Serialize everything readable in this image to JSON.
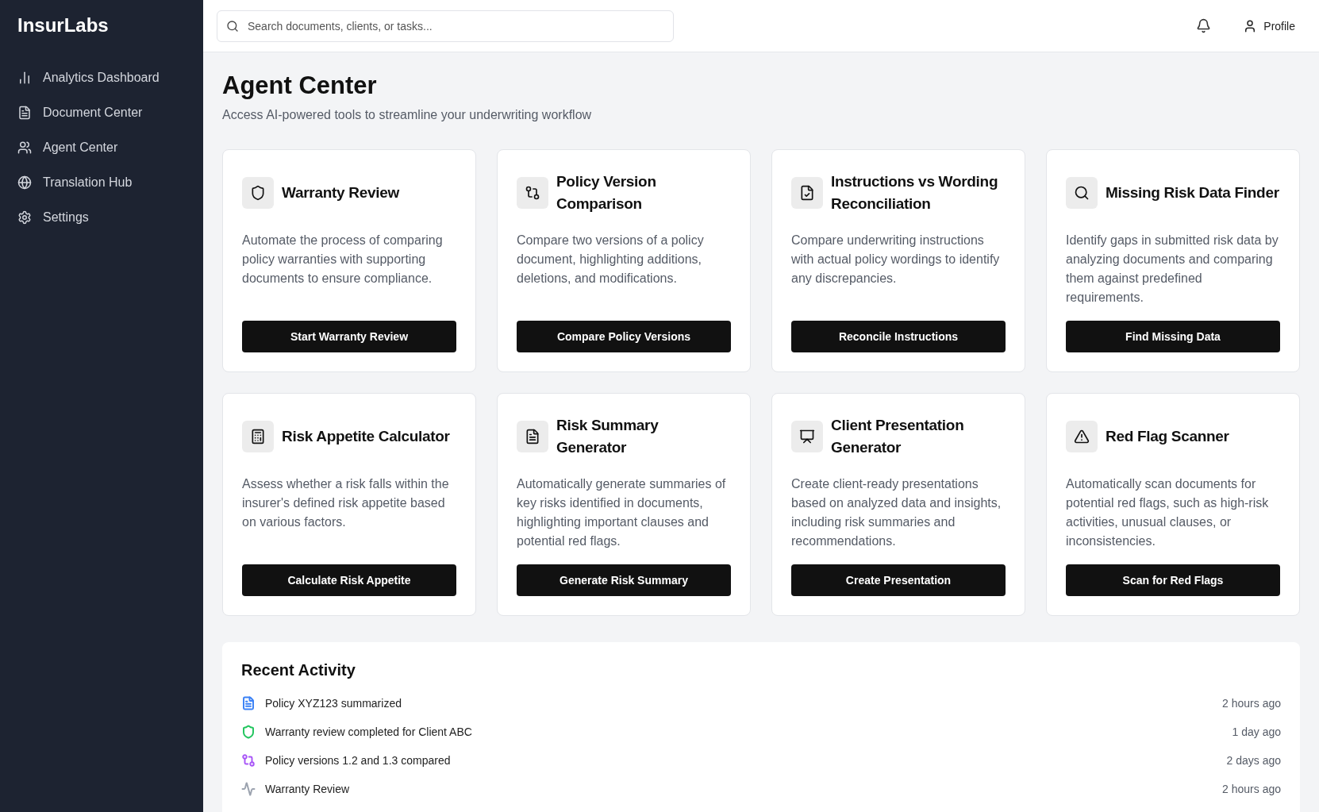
{
  "sidebar": {
    "brand": "InsurLabs",
    "items": [
      {
        "label": "Analytics Dashboard"
      },
      {
        "label": "Document Center"
      },
      {
        "label": "Agent Center"
      },
      {
        "label": "Translation Hub"
      },
      {
        "label": "Settings"
      }
    ]
  },
  "header": {
    "search": {
      "placeholder": "Search documents, clients, or tasks..."
    },
    "profile": "Profile"
  },
  "page": {
    "title": "Agent Center",
    "subtitle": "Access AI-powered tools to streamline your underwriting workflow"
  },
  "tools": [
    {
      "title": "Warranty Review",
      "description": "Automate the process of comparing policy warranties with supporting documents to ensure compliance.",
      "action": "Start Warranty Review"
    },
    {
      "title": "Policy Version Comparison",
      "description": "Compare two versions of a policy document, highlighting additions, deletions, and modifications.",
      "action": "Compare Policy Versions"
    },
    {
      "title": "Instructions vs Wording Reconciliation",
      "description": "Compare underwriting instructions with actual policy wordings to identify any discrepancies.",
      "action": "Reconcile Instructions"
    },
    {
      "title": "Missing Risk Data Finder",
      "description": "Identify gaps in submitted risk data by analyzing documents and comparing them against predefined requirements.",
      "action": "Find Missing Data"
    },
    {
      "title": "Risk Appetite Calculator",
      "description": "Assess whether a risk falls within the insurer's defined risk appetite based on various factors.",
      "action": "Calculate Risk Appetite"
    },
    {
      "title": "Risk Summary Generator",
      "description": "Automatically generate summaries of key risks identified in documents, highlighting important clauses and potential red flags.",
      "action": "Generate Risk Summary"
    },
    {
      "title": "Client Presentation Generator",
      "description": "Create client-ready presentations based on analyzed data and insights, including risk summaries and recommendations.",
      "action": "Create Presentation"
    },
    {
      "title": "Red Flag Scanner",
      "description": "Automatically scan documents for potential red flags, such as high-risk activities, unusual clauses, or inconsistencies.",
      "action": "Scan for Red Flags"
    }
  ],
  "recent_activity": {
    "title": "Recent Activity",
    "items": [
      {
        "text": "Policy XYZ123 summarized",
        "time": "2 hours ago",
        "color": "#3b82f6"
      },
      {
        "text": "Warranty review completed for Client ABC",
        "time": "1 day ago",
        "color": "#22c55e"
      },
      {
        "text": "Policy versions 1.2 and 1.3 compared",
        "time": "2 days ago",
        "color": "#a855f7"
      },
      {
        "text": "Warranty Review",
        "time": "2 hours ago",
        "color": "#9ca3af"
      }
    ]
  }
}
